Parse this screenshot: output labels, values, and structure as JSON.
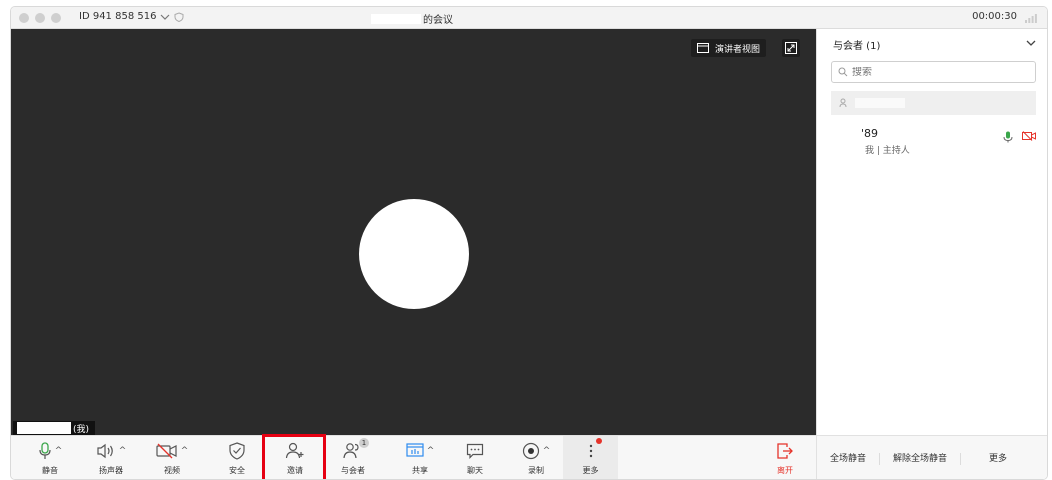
{
  "titlebar": {
    "meeting_id": "ID 941 858 516",
    "title_suffix": "的会议",
    "timer": "00:00:30"
  },
  "video": {
    "speaker_view_label": "演讲者视图",
    "self_tag": "(我)"
  },
  "toolbar": {
    "mute_label": "静音",
    "speaker_label": "扬声器",
    "video_label": "视频",
    "security_label": "安全",
    "invite_label": "邀请",
    "participants_label": "与会者",
    "participants_badge": "1",
    "share_label": "共享",
    "chat_label": "聊天",
    "record_label": "录制",
    "more_label": "更多",
    "leave_label": "离开"
  },
  "sidebar": {
    "header": "与会者 (1)",
    "search_placeholder": "搜索",
    "participant_name_visible": "'89",
    "participant_role": "我 | 主持人",
    "footer": {
      "mute_all": "全场静音",
      "unmute_all": "解除全场静音",
      "more": "更多"
    }
  },
  "colors": {
    "video_bg": "#2b2b2b",
    "highlight_red": "#e60012",
    "leave_red": "#e5332a",
    "mic_green": "#3aa64a",
    "share_blue": "#2d8cf0"
  }
}
